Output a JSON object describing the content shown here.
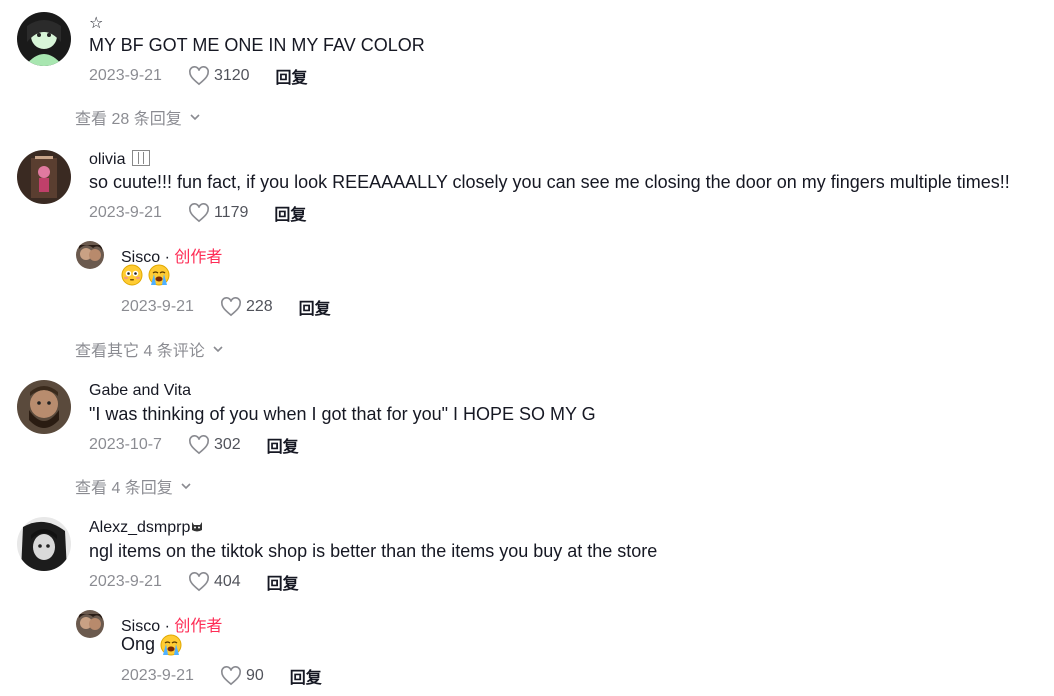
{
  "comments": [
    {
      "username": "☆",
      "text": "MY BF GOT ME ONE IN MY FAV COLOR",
      "date": "2023-9-21",
      "likes": "3120",
      "reply_label": "回复",
      "view_more": "查看 28 条回复"
    },
    {
      "username": "olivia",
      "text": "so cuute!!! fun fact, if you look REEAAAALLY closely you can see me closing the door on my fingers multiple times!!",
      "date": "2023-9-21",
      "likes": "1179",
      "reply_label": "回复",
      "reply": {
        "username": "Sisco",
        "separator": "·",
        "author_tag": "创作者",
        "date": "2023-9-21",
        "likes": "228",
        "reply_label": "回复"
      },
      "view_more": "查看其它 4 条评论"
    },
    {
      "username": "Gabe and Vita",
      "text": "\"I was thinking of you when I got that for you\" I HOPE SO MY G",
      "date": "2023-10-7",
      "likes": "302",
      "reply_label": "回复",
      "view_more": "查看 4 条回复"
    },
    {
      "username": "Alexz_dsmprp",
      "text": "ngl items on the tiktok shop is better than the items you buy at the store",
      "date": "2023-9-21",
      "likes": "404",
      "reply_label": "回复",
      "reply": {
        "username": "Sisco",
        "separator": "·",
        "author_tag": "创作者",
        "text": "Ong",
        "date": "2023-9-21",
        "likes": "90",
        "reply_label": "回复"
      }
    }
  ],
  "icons": {
    "like": "heart-outline-icon",
    "expand": "chevron-down-icon",
    "emoji_flushed": "flushed-face-emoji",
    "emoji_crying": "loudly-crying-face-emoji",
    "author_emoji": "cat-face-emoji"
  },
  "colors": {
    "text": "#161823",
    "muted": "#8a8b91",
    "author": "#fe2c55"
  }
}
